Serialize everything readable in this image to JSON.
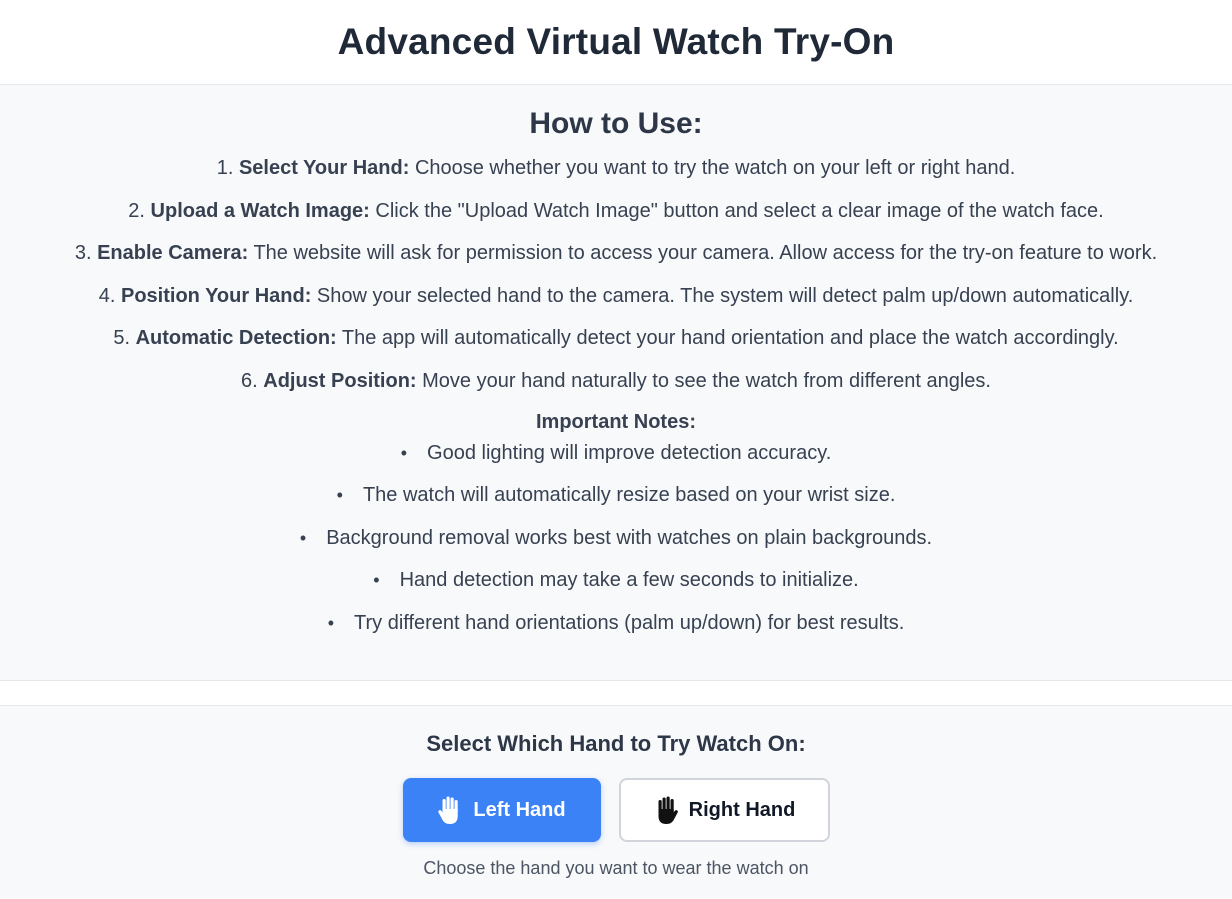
{
  "header": {
    "title": "Advanced Virtual Watch Try-On"
  },
  "instructions": {
    "title": "How to Use:",
    "steps": [
      {
        "number": "1.",
        "label": "Select Your Hand:",
        "text": "Choose whether you want to try the watch on your left or right hand."
      },
      {
        "number": "2.",
        "label": "Upload a Watch Image:",
        "text": "Click the \"Upload Watch Image\" button and select a clear image of the watch face."
      },
      {
        "number": "3.",
        "label": "Enable Camera:",
        "text": "The website will ask for permission to access your camera. Allow access for the try-on feature to work."
      },
      {
        "number": "4.",
        "label": "Position Your Hand:",
        "text": "Show your selected hand to the camera. The system will detect palm up/down automatically."
      },
      {
        "number": "5.",
        "label": "Automatic Detection:",
        "text": "The app will automatically detect your hand orientation and place the watch accordingly."
      },
      {
        "number": "6.",
        "label": "Adjust Position:",
        "text": "Move your hand naturally to see the watch from different angles."
      }
    ],
    "notes_title": "Important Notes:",
    "notes": [
      "Good lighting will improve detection accuracy.",
      "The watch will automatically resize based on your wrist size.",
      "Background removal works best with watches on plain backgrounds.",
      "Hand detection may take a few seconds to initialize.",
      "Try different hand orientations (palm up/down) for best results."
    ]
  },
  "hand_select": {
    "title": "Select Which Hand to Try Watch On:",
    "left_label": "Left Hand",
    "right_label": "Right Hand",
    "left_icon": "raised-hand-icon",
    "right_icon": "raised-hand-icon",
    "selected": "Left Hand",
    "hint": "Choose the hand you want to wear the watch on",
    "accent_color": "#3b82f6"
  }
}
